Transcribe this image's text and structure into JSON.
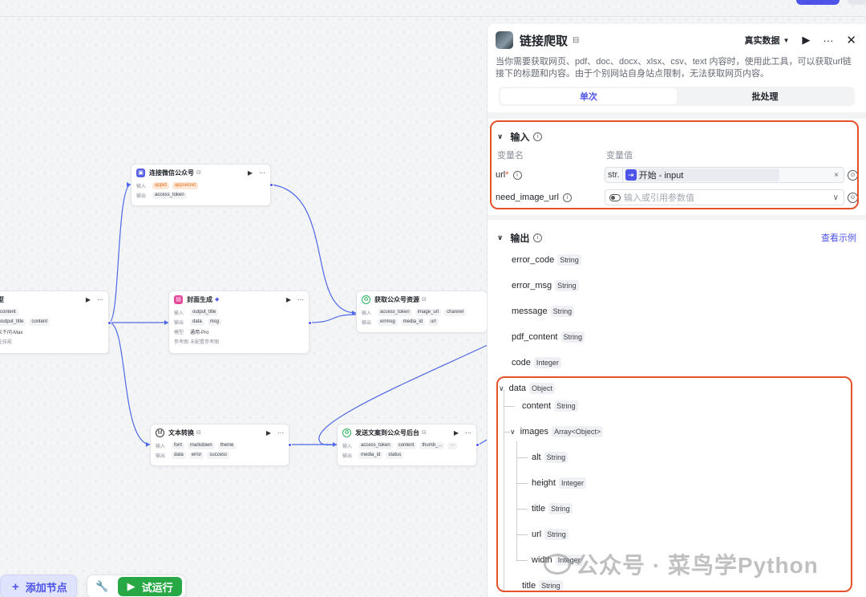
{
  "canvas": {
    "nodes": {
      "wechat_link": {
        "title": "连接微信公众号",
        "badge": "⊟",
        "row1_label": "输入",
        "row1_tags": [
          "appid",
          "appsecret"
        ],
        "row2_label": "输出",
        "row2_tags": [
          "access_token"
        ]
      },
      "left_model": {
        "title": "型",
        "row1_tags": [
          "content"
        ],
        "row2_tags": [
          "output_title",
          "content"
        ],
        "row3_text": "义千问-Max",
        "row4_text": "无技能"
      },
      "cover": {
        "title": "封面生成",
        "badge": "◆",
        "row1_label": "输入",
        "row1_tags": [
          "output_title"
        ],
        "row2_label": "输出",
        "row2_tags": [
          "data",
          "msg"
        ],
        "row3_label": "模型",
        "row3_text": "通用-Pro",
        "row4_label": "参考图",
        "row4_text": "未配置参考图"
      },
      "get_resource": {
        "title": "获取公众号资源",
        "badge": "⊟",
        "row1_label": "输入",
        "row1_tags": [
          "access_token",
          "image_url",
          "channel"
        ],
        "row2_label": "输出",
        "row2_tags": [
          "errmsg",
          "media_id",
          "url"
        ]
      },
      "text_convert": {
        "title": "文本转换",
        "badge": "⊟",
        "row1_label": "输入",
        "row1_tags": [
          "font",
          "markdown",
          "theme"
        ],
        "row2_label": "输出",
        "row2_tags": [
          "data",
          "error",
          "success"
        ]
      },
      "send_article": {
        "title": "发送文案到公众号后台",
        "badge": "⊟",
        "row1_label": "输入",
        "row1_tags": [
          "access_token",
          "content",
          "thumb_..."
        ],
        "row2_label": "输出",
        "row2_tags": [
          "media_id",
          "status"
        ]
      }
    }
  },
  "bottom": {
    "add_node_label": "添加节点",
    "run_label": "试运行"
  },
  "panel": {
    "title": "链接爬取",
    "mode_label": "真实数据",
    "description": "当你需要获取网页、pdf、doc、docx、xlsx、csv、text 内容时，使用此工具，可以获取url链接下的标题和内容。由于个别网站自身站点限制，无法获取网页内容。",
    "tabs": [
      {
        "label": "单次",
        "active": true
      },
      {
        "label": "批处理",
        "active": false
      }
    ],
    "input": {
      "heading": "输入",
      "col_name": "变量名",
      "col_value": "变量值",
      "rows": [
        {
          "name": "url",
          "required": "*",
          "type_tag": "str.",
          "ref": "开始 - input"
        },
        {
          "name": "need_image_url",
          "placeholder": "输入或引用参数值"
        }
      ]
    },
    "output": {
      "heading": "输出",
      "view_example": "查看示例",
      "items": [
        {
          "name": "error_code",
          "type": "String"
        },
        {
          "name": "error_msg",
          "type": "String"
        },
        {
          "name": "message",
          "type": "String"
        },
        {
          "name": "pdf_content",
          "type": "String"
        },
        {
          "name": "code",
          "type": "Integer"
        },
        {
          "name": "data",
          "type": "Object"
        },
        {
          "name": "content",
          "type": "String"
        },
        {
          "name": "images",
          "type": "Array<Object>"
        },
        {
          "name": "alt",
          "type": "String"
        },
        {
          "name": "height",
          "type": "Integer"
        },
        {
          "name": "title",
          "type": "String"
        },
        {
          "name": "url",
          "type": "String"
        },
        {
          "name": "width",
          "type": "Integer"
        },
        {
          "name": "title",
          "type": "String"
        }
      ]
    }
  },
  "watermark": "公众号 · 菜鸟学Python",
  "colors": {
    "accent": "#4d53e8",
    "highlight_box": "#e4532b",
    "run_green": "#28a745"
  }
}
